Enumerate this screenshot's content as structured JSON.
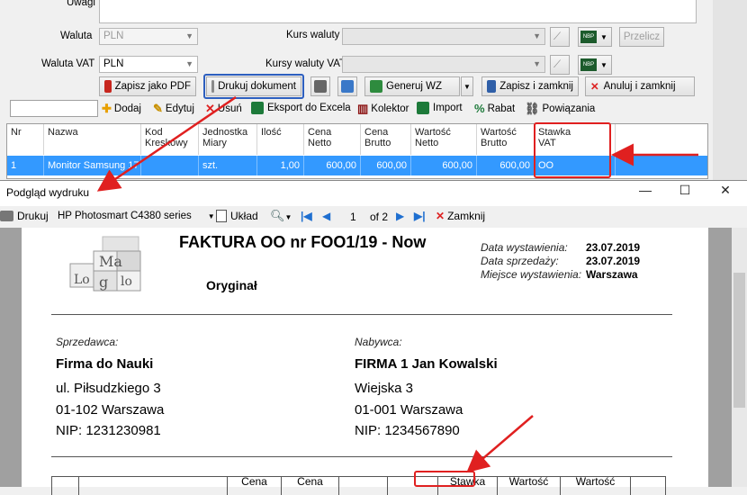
{
  "back": {
    "uwagi_label": "Uwagi",
    "waluta_label": "Waluta",
    "waluta_value": "PLN",
    "waluta_vat_label": "Waluta VAT",
    "waluta_vat_value": "PLN",
    "kurs_label": "Kurs waluty",
    "kurs_vat_label": "Kursy waluty VAT",
    "przelicz": "Przelicz",
    "buttons": {
      "pdf": "Zapisz jako PDF",
      "print": "Drukuj dokument",
      "wz": "Generuj WZ",
      "save_close": "Zapisz i zamknij",
      "cancel_close": "Anuluj i zamknij"
    },
    "toolbar": {
      "add": "Dodaj",
      "edit": "Edytuj",
      "delete": "Usuń",
      "export": "Eksport do Excela",
      "collector": "Kolektor",
      "import": "Import",
      "discount": "Rabat",
      "links": "Powiązania"
    },
    "grid": {
      "headers": [
        "Nr",
        "Nazwa",
        "Kod\nKreskowy",
        "Jednostka\nMiary",
        "Ilość",
        "Cena\nNetto",
        "Cena\nBrutto",
        "Wartość\nNetto",
        "Wartość\nBrutto",
        "Stawka\nVAT"
      ],
      "row": [
        "1",
        "Monitor Samsung 17",
        "",
        "szt.",
        "1,00",
        "600,00",
        "600,00",
        "600,00",
        "600,00",
        "OO"
      ]
    }
  },
  "preview": {
    "title": "Podgląd wydruku",
    "controls": {
      "minimize": "—",
      "maximize": "☐",
      "close": "✕"
    },
    "toolbar": {
      "print": "Drukuj",
      "printer": "HP Photosmart C4380 series",
      "layout": "Układ",
      "page": "1",
      "of": "of 2",
      "close": "Zamknij"
    },
    "invoice": {
      "title": "FAKTURA OO nr FOO1/19 - Now",
      "original": "Oryginał",
      "date_issue_label": "Data wystawienia:",
      "date_issue": "23.07.2019",
      "date_sale_label": "Data sprzedaży:",
      "date_sale": "23.07.2019",
      "place_label": "Miejsce wystawienia:",
      "place": "Warszawa",
      "seller_label": "Sprzedawca:",
      "seller_name": "Firma do Nauki",
      "seller_street": "ul. Piłsudzkiego 3",
      "seller_city": "01-102  Warszawa",
      "seller_nip": "NIP: 1231230981",
      "buyer_label": "Nabywca:",
      "buyer_name": "FIRMA 1 Jan Kowalski",
      "buyer_street": "Wiejska 3",
      "buyer_city": "01-001  Warszawa",
      "buyer_nip": "NIP: 1234567890",
      "table_headers": [
        "Cena",
        "Cena",
        "Stawka",
        "Wartość",
        "Wartość"
      ]
    }
  },
  "colors": {
    "accent": "#3399ff",
    "highlight": "#e02020"
  }
}
